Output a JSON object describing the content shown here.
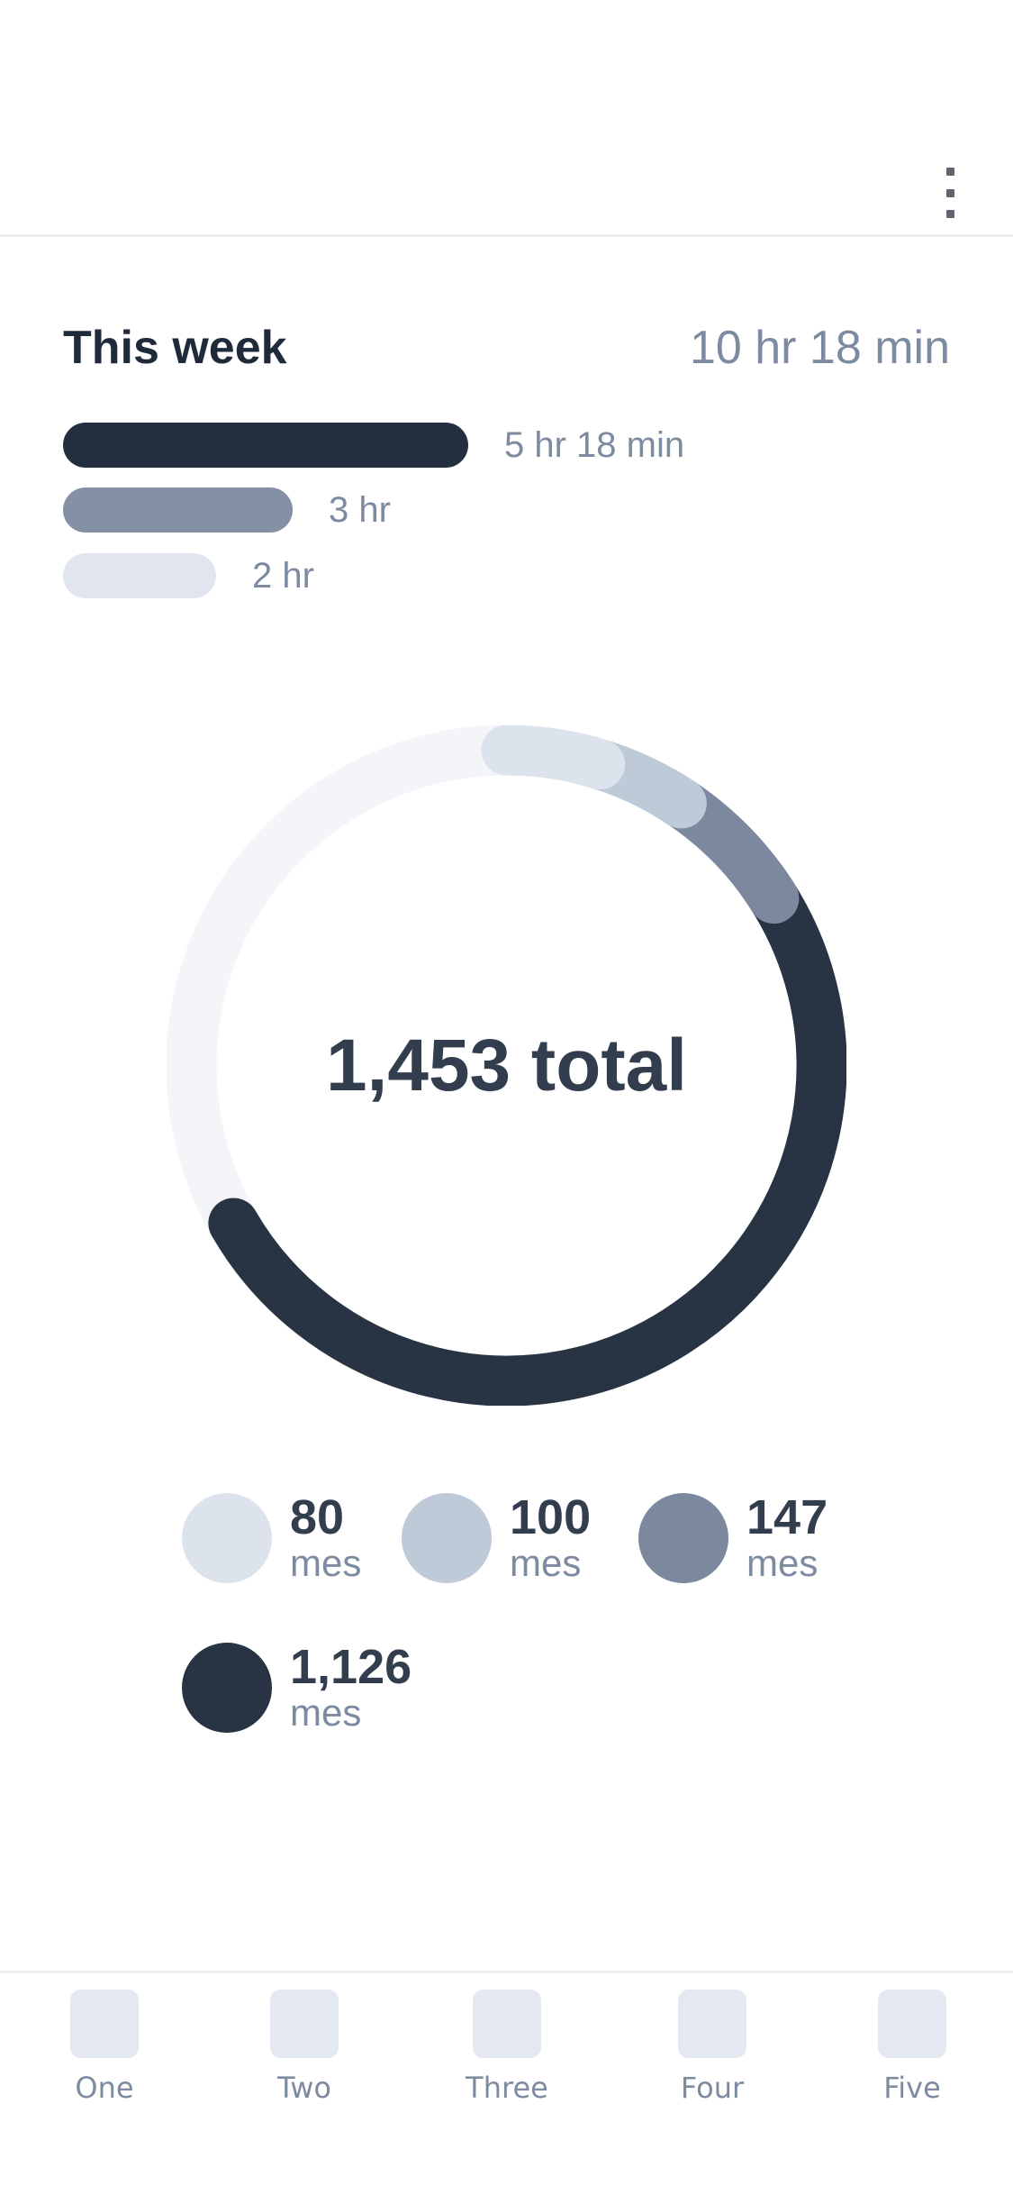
{
  "header": {
    "menu_icon": "more-vertical-icon"
  },
  "week": {
    "title": "This week",
    "total": "10 hr 18 min",
    "bars": [
      {
        "label": "5 hr 18 min",
        "minutes": 318,
        "color": "#232f3e"
      },
      {
        "label": "3 hr",
        "minutes": 180,
        "color": "#8491a4"
      },
      {
        "label": "2 hr",
        "minutes": 120,
        "color": "#e1e6ee"
      }
    ]
  },
  "chart_data": {
    "type": "donut",
    "center_label": "1,453 total",
    "total": 1453,
    "segments": [
      {
        "value": 80,
        "label": "80",
        "unit": "mes",
        "color": "#dde3ec"
      },
      {
        "value": 100,
        "label": "100",
        "unit": "mes",
        "color": "#bfcad8"
      },
      {
        "value": 147,
        "label": "147",
        "unit": "mes",
        "color": "#7b889e"
      },
      {
        "value": 1126,
        "label": "1,126",
        "unit": "mes",
        "color": "#283444"
      }
    ],
    "track_color": "#f3f5f9"
  },
  "nav": {
    "items": [
      {
        "label": "One"
      },
      {
        "label": "Two"
      },
      {
        "label": "Three"
      },
      {
        "label": "Four"
      },
      {
        "label": "Five"
      }
    ]
  }
}
